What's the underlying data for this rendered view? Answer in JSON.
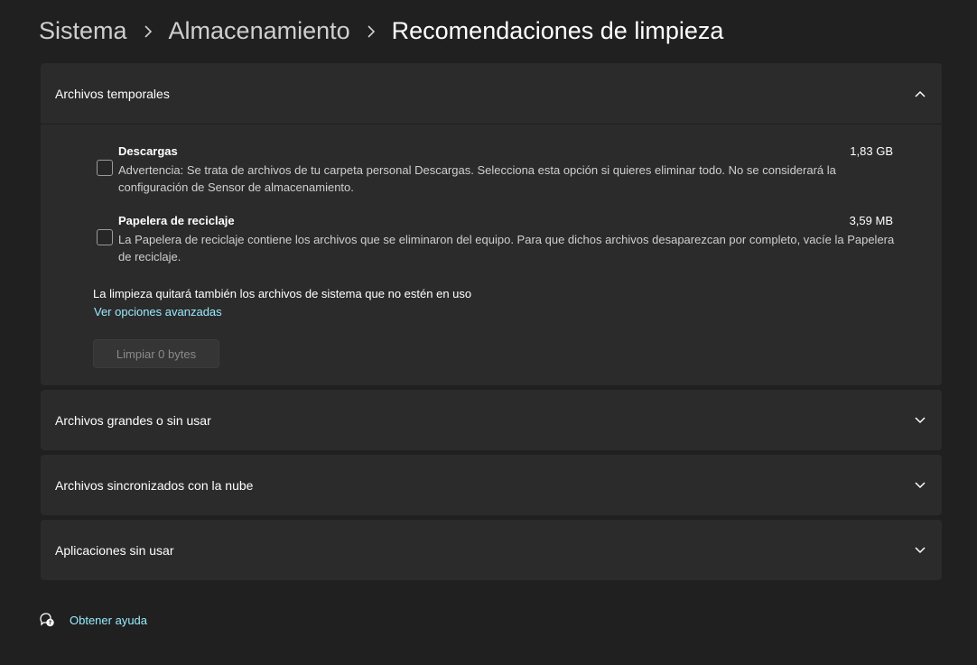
{
  "breadcrumb": {
    "items": [
      "Sistema",
      "Almacenamiento",
      "Recomendaciones de limpieza"
    ]
  },
  "sections": {
    "temp": {
      "title": "Archivos temporales",
      "expanded": true,
      "items": [
        {
          "title": "Descargas",
          "size": "1,83 GB",
          "description": "Advertencia: Se trata de archivos de tu carpeta personal Descargas. Selecciona esta opción si quieres eliminar todo. No se considerará la configuración de Sensor de almacenamiento.",
          "checked": false
        },
        {
          "title": "Papelera de reciclaje",
          "size": "3,59 MB",
          "description": "La Papelera de reciclaje contiene los archivos que se eliminaron del equipo. Para que dichos archivos desaparezcan por completo, vacíe la Papelera de reciclaje.",
          "checked": false
        }
      ],
      "cleanup_note": "La limpieza quitará también los archivos de sistema que no estén en uso",
      "advanced_link": "Ver opciones avanzadas",
      "clean_button": "Limpiar 0 bytes"
    },
    "large": {
      "title": "Archivos grandes o sin usar",
      "expanded": false
    },
    "cloud": {
      "title": "Archivos sincronizados con la nube",
      "expanded": false
    },
    "apps": {
      "title": "Aplicaciones sin usar",
      "expanded": false
    }
  },
  "help": {
    "label": "Obtener ayuda",
    "icon": "help-chat-icon"
  },
  "colors": {
    "background": "#202020",
    "panel": "#2b2b2b",
    "link": "#99ebff",
    "text_secondary": "#cfcfcf"
  }
}
